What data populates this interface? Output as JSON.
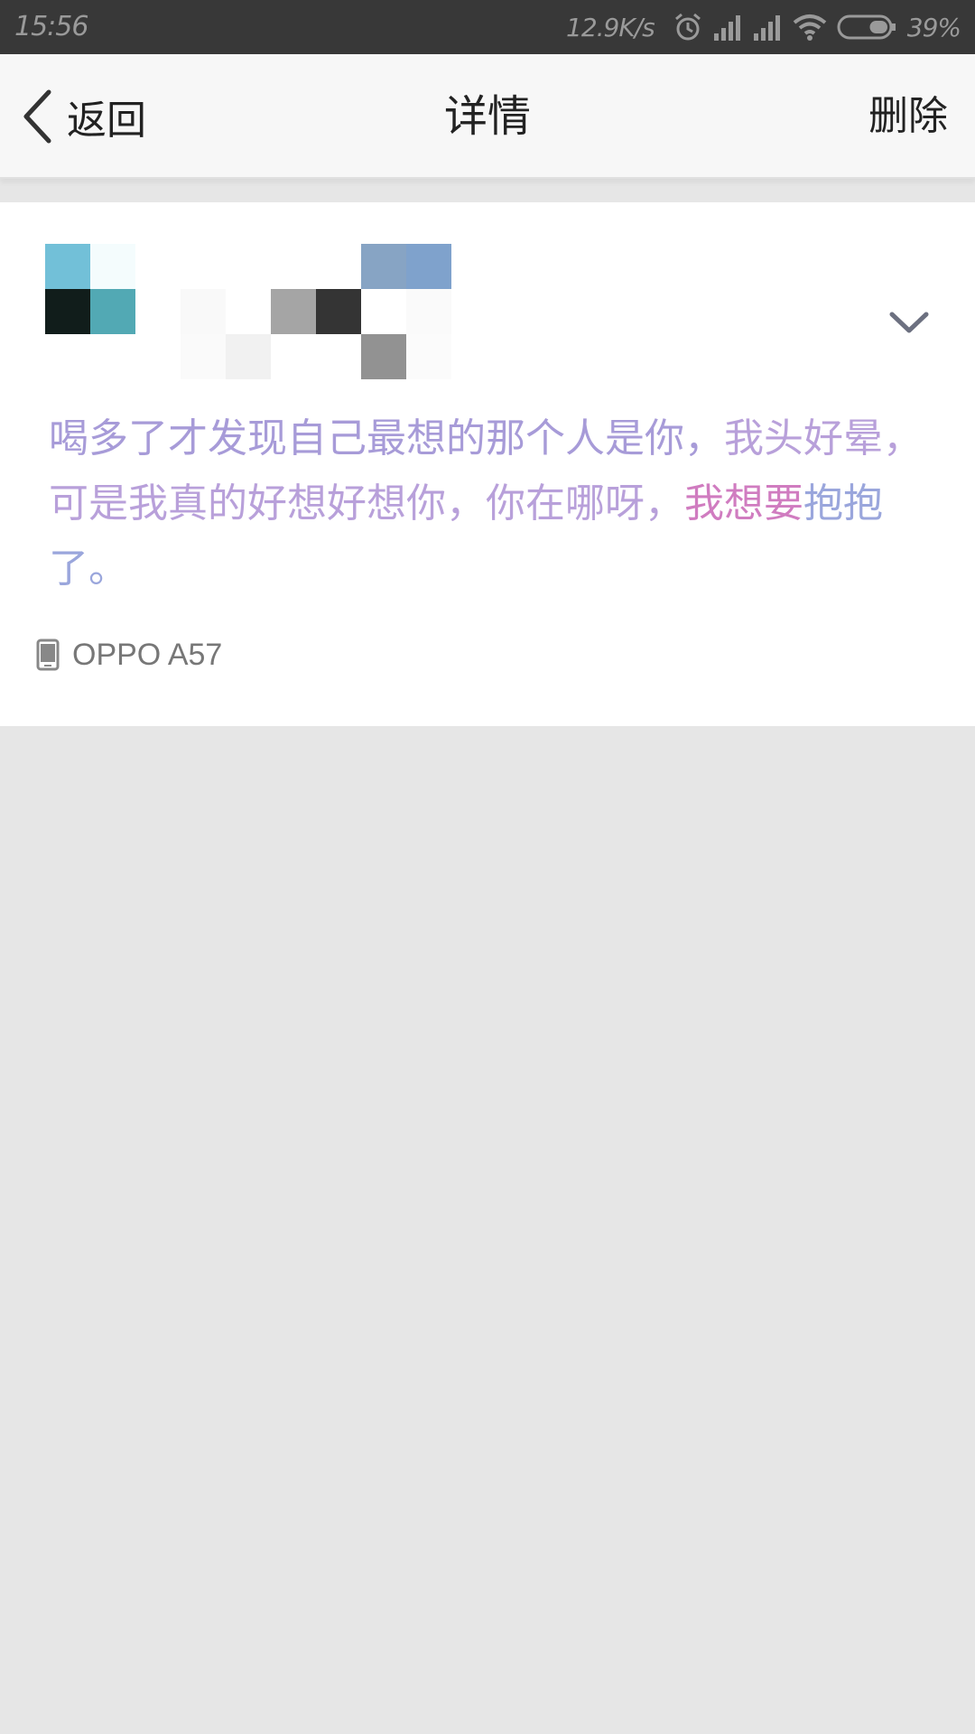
{
  "status_bar": {
    "time": "15:56",
    "net_speed": "12.9K/s",
    "battery_percent": "39%",
    "battery_level": 0.39,
    "icons": [
      "alarm-icon",
      "signal-icon",
      "signal-icon",
      "wifi-icon",
      "battery-icon"
    ]
  },
  "nav": {
    "back_label": "返回",
    "title": "详情",
    "delete_label": "删除",
    "back_icon": "chevron-left-icon"
  },
  "post": {
    "text_segments": [
      {
        "text": "喝多了才发现自己最想的那个人是你，",
        "color": "#a79bd8"
      },
      {
        "text": "我头好晕，可是我真的好想好想你，你在哪呀，",
        "color": "#b8a0da"
      },
      {
        "text": "我想要",
        "color": "#d07cc0"
      },
      {
        "text": "抱抱了。",
        "color": "#9aa6dc"
      }
    ],
    "device": "OPPO A57",
    "device_icon": "phone-icon",
    "expand_icon": "chevron-down-icon",
    "avatar_colors": [
      "#72c0d8",
      "#f4fcfd",
      "#111d1b",
      "#52a9b4"
    ],
    "username_mosaic_colors": [
      "#ffffff",
      "#ffffff",
      "#ffffff",
      "#ffffff",
      "#87a4c4",
      "#7fa2cc",
      "#f9f9f9",
      "#ffffff",
      "#a5a5a5",
      "#343434",
      "#ffffff",
      "#fafafa",
      "#fafafa",
      "#f1f1f1",
      "#ffffff",
      "#ffffff",
      "#929292",
      "#fbfbfb"
    ]
  },
  "colors": {
    "status_bar_bg": "#383838",
    "nav_bg": "#f7f7f7",
    "page_bg": "#e6e6e6",
    "card_bg": "#ffffff"
  }
}
